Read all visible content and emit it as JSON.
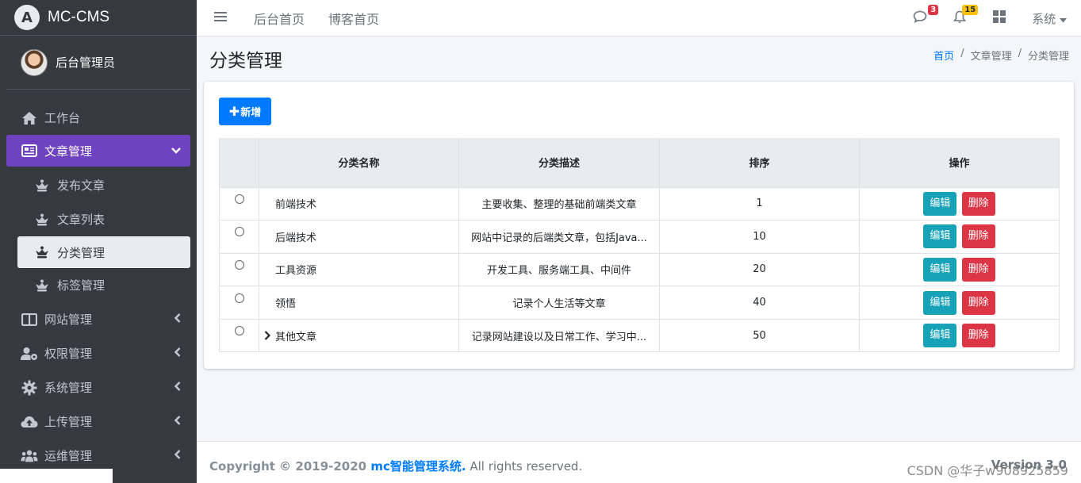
{
  "brand": {
    "logo_letter": "A",
    "name": "MC-CMS"
  },
  "user": {
    "name": "后台管理员"
  },
  "sidebar": {
    "items": [
      {
        "label": "工作台",
        "icon": "home-icon"
      },
      {
        "label": "文章管理",
        "icon": "newspaper-icon",
        "active": true,
        "children": [
          {
            "label": "发布文章"
          },
          {
            "label": "文章列表"
          },
          {
            "label": "分类管理",
            "selected": true
          },
          {
            "label": "标签管理"
          }
        ]
      },
      {
        "label": "网站管理",
        "icon": "columns-icon"
      },
      {
        "label": "权限管理",
        "icon": "user-cog-icon"
      },
      {
        "label": "系统管理",
        "icon": "gear-icon"
      },
      {
        "label": "上传管理",
        "icon": "cloud-upload-icon"
      },
      {
        "label": "运维管理",
        "icon": "users-icon"
      }
    ]
  },
  "topbar": {
    "links": [
      "后台首页",
      "博客首页"
    ],
    "messages_count": "3",
    "notifications_count": "15",
    "system_label": "系统"
  },
  "page": {
    "title": "分类管理",
    "breadcrumb": [
      "首页",
      "文章管理",
      "分类管理"
    ]
  },
  "toolbar": {
    "add_label": "新增"
  },
  "table": {
    "columns": [
      "分类名称",
      "分类描述",
      "排序",
      "操作"
    ],
    "edit_label": "编辑",
    "delete_label": "删除",
    "rows": [
      {
        "name": "前端技术",
        "desc": "主要收集、整理的基础前端类文章",
        "order": "1"
      },
      {
        "name": "后端技术",
        "desc": "网站中记录的后端类文章，包括Java...",
        "order": "10"
      },
      {
        "name": "工具资源",
        "desc": "开发工具、服务端工具、中间件",
        "order": "20"
      },
      {
        "name": "领悟",
        "desc": "记录个人生活等文章",
        "order": "40"
      },
      {
        "name": "其他文章",
        "desc": "记录网站建设以及日常工作、学习中...",
        "order": "50",
        "expandable": true
      }
    ]
  },
  "footer": {
    "copyright_prefix": "Copyright © 2019-2020 ",
    "system_name": "mc智能管理系统.",
    "rights": " All rights reserved.",
    "version": "Version 3.0"
  },
  "watermark": "CSDN @华子w908925859",
  "colors": {
    "sidebar": "#343a40",
    "active_menu": "#6f42c1",
    "primary": "#007bff",
    "edit": "#17a2b8",
    "delete": "#dc3545"
  }
}
